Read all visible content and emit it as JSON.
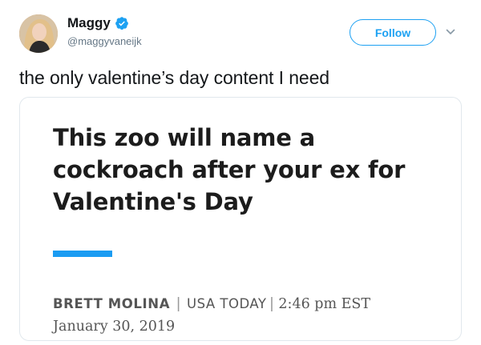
{
  "user": {
    "name": "Maggy",
    "handle": "@maggyvaneijk",
    "verified_icon": "verified-badge-icon",
    "avatar": "profile-photo"
  },
  "follow_label": "Follow",
  "menu_icon": "chevron-down-icon",
  "tweet_text": "the only valentine’s day content I need",
  "card": {
    "headline": "This zoo will name a cockroach after your ex for Valentine's Day",
    "author": "BRETT MOLINA",
    "separator": "|",
    "publisher": "USA TODAY",
    "time": "2:46 pm EST",
    "date": "January 30, 2019"
  },
  "colors": {
    "accent": "#1da1f2",
    "card_bar": "#1b9cf2",
    "text": "#14171a",
    "muted": "#657786"
  }
}
